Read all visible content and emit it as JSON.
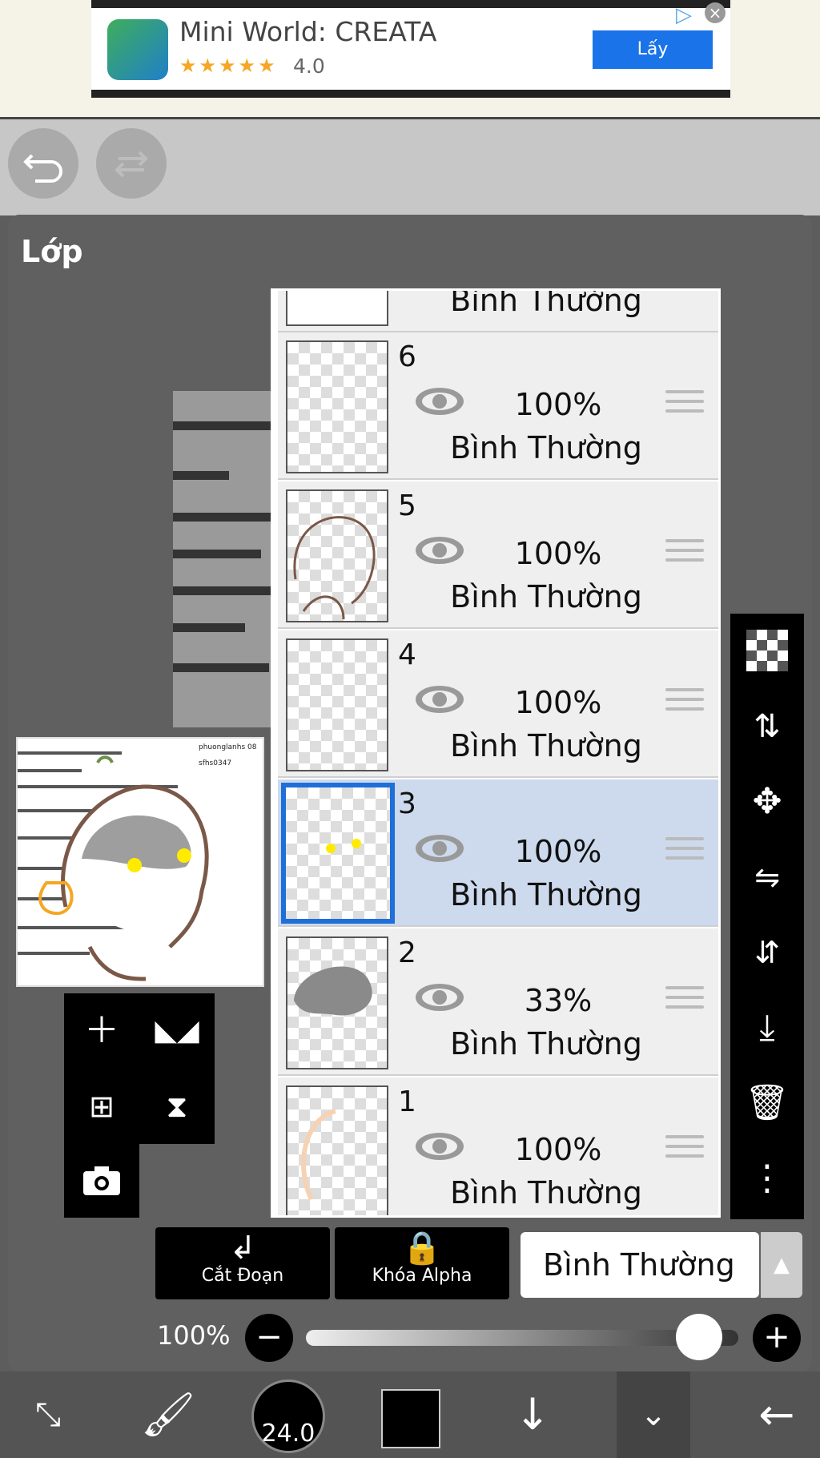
{
  "ad": {
    "title": "Mini World: CREATA",
    "stars": "★★★★★",
    "rating": "4.0",
    "button": "Lấy"
  },
  "panel": {
    "title": "Lớp"
  },
  "layers": [
    {
      "num": "",
      "opacity": "",
      "mode": "Bình Thường",
      "selected": false
    },
    {
      "num": "6",
      "opacity": "100%",
      "mode": "Bình Thường",
      "selected": false
    },
    {
      "num": "5",
      "opacity": "100%",
      "mode": "Bình Thường",
      "selected": false
    },
    {
      "num": "4",
      "opacity": "100%",
      "mode": "Bình Thường",
      "selected": false
    },
    {
      "num": "3",
      "opacity": "100%",
      "mode": "Bình Thường",
      "selected": true
    },
    {
      "num": "2",
      "opacity": "33%",
      "mode": "Bình Thường",
      "selected": false
    },
    {
      "num": "1",
      "opacity": "100%",
      "mode": "Bình Thường",
      "selected": false
    }
  ],
  "bottom_actions": {
    "clip_label": "Cắt Đoạn",
    "alpha_label": "Khóa Alpha",
    "blend_mode": "Bình Thường"
  },
  "opacity": {
    "label": "100%",
    "value": 1.0
  },
  "brush_size": "24.0",
  "preview_text": [
    "phuonglanhs 08",
    "sfhs0347"
  ],
  "colors": {
    "panel": "#606060",
    "selected_layer": "#cdd9ec",
    "selection_border": "#1e6fd9",
    "ad_button": "#1a73e8"
  },
  "icons": {
    "undo": "undo-icon",
    "redo": "redo-icon",
    "eye": "eye-icon",
    "grip": "drag-handle-icon"
  }
}
